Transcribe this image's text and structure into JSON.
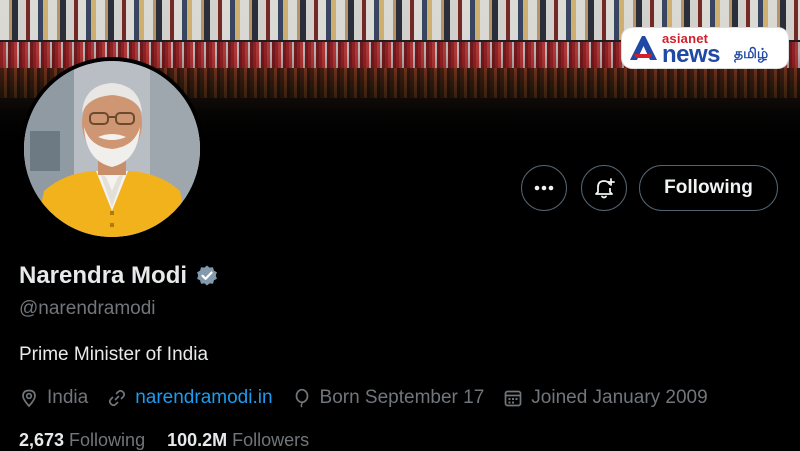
{
  "watermark": {
    "brand_top": "asianet",
    "brand_main": "news",
    "brand_lang": "தமிழ்"
  },
  "actions": {
    "more_icon": "more-icon",
    "bell_icon": "bell-plus-icon",
    "follow_label": "Following"
  },
  "profile": {
    "name": "Narendra Modi",
    "handle": "@narendramodi",
    "bio": "Prime Minister of India",
    "location": "India",
    "website": "narendramodi.in",
    "born": "Born September 17",
    "joined": "Joined January 2009",
    "following_count": "2,673",
    "following_label": "Following",
    "followers_count": "100.2M",
    "followers_label": "Followers"
  },
  "colors": {
    "background": "#000000",
    "text": "#e7e9ea",
    "muted": "#71767b",
    "link": "#1d9bf0",
    "border": "#536471"
  }
}
